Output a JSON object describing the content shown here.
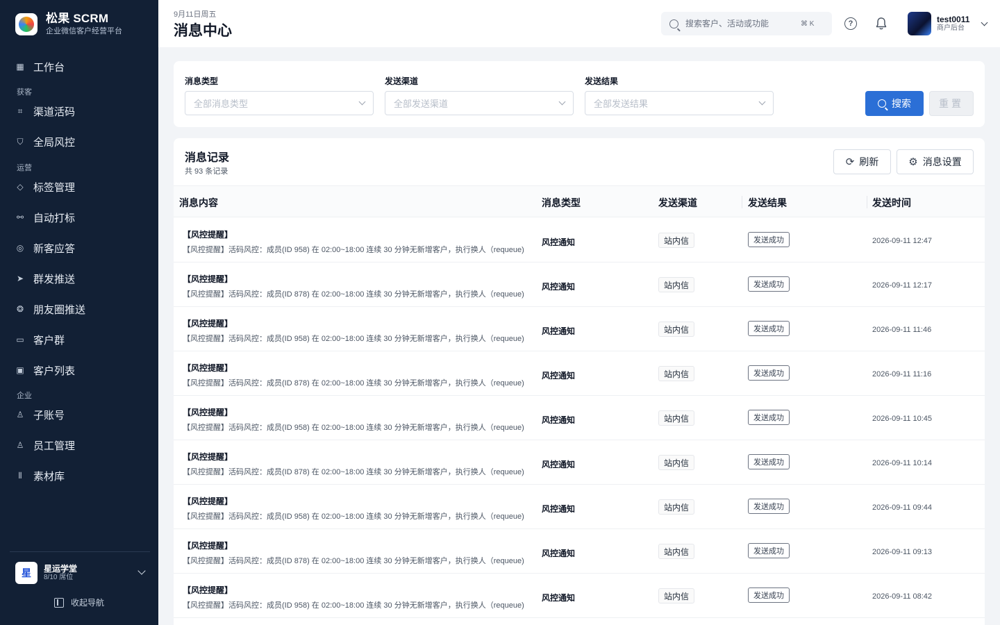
{
  "brand": {
    "title": "松果 SCRM",
    "subtitle": "企业微信客户经营平台"
  },
  "sidebar": {
    "groups": {
      "acquire": "获客",
      "operate": "运营",
      "enterprise": "企业"
    },
    "items": [
      {
        "label": "工作台",
        "icon": "dashboard-icon"
      },
      {
        "label": "渠道活码",
        "icon": "qrcode-icon"
      },
      {
        "label": "全局风控",
        "icon": "shield-icon"
      },
      {
        "label": "标签管理",
        "icon": "tag-icon"
      },
      {
        "label": "自动打标",
        "icon": "auto-tag-icon"
      },
      {
        "label": "新客应答",
        "icon": "chat-reply-icon"
      },
      {
        "label": "群发推送",
        "icon": "send-icon"
      },
      {
        "label": "朋友圈推送",
        "icon": "moments-icon"
      },
      {
        "label": "客户群",
        "icon": "group-chat-icon"
      },
      {
        "label": "客户列表",
        "icon": "contact-icon"
      },
      {
        "label": "子账号",
        "icon": "user-icon"
      },
      {
        "label": "员工管理",
        "icon": "staff-icon"
      },
      {
        "label": "素材库",
        "icon": "library-icon"
      }
    ],
    "workspace": {
      "avatar": "星",
      "name": "星运学堂",
      "seats": "8/10 席位"
    },
    "collapse_label": "收起导航"
  },
  "header": {
    "date": "9月11日周五",
    "title": "消息中心",
    "search_placeholder": "搜索客户、活动或功能",
    "shortcut": "⌘ K",
    "user_name": "test0011",
    "user_role": "商户后台"
  },
  "filters": {
    "type": {
      "label": "消息类型",
      "placeholder": "全部消息类型"
    },
    "channel": {
      "label": "发送渠道",
      "placeholder": "全部发送渠道"
    },
    "result": {
      "label": "发送结果",
      "placeholder": "全部发送结果"
    },
    "search_label": "搜索",
    "reset_label": "重置"
  },
  "records": {
    "title": "消息记录",
    "count": "共 93 条记录",
    "refresh_label": "刷新",
    "settings_label": "消息设置",
    "columns": [
      "消息内容",
      "消息类型",
      "发送渠道",
      "发送结果",
      "发送时间"
    ],
    "rows": [
      {
        "title": "【风控提醒】",
        "desc": "【风控提醒】活码风控：成员(ID 958) 在 02:00~18:00 连续 30 分钟无新增客户，执行换人（requeue)",
        "type": "风控通知",
        "channel": "站内信",
        "result": "发送成功",
        "time": "2026-09-11 12:47"
      },
      {
        "title": "【风控提醒】",
        "desc": "【风控提醒】活码风控：成员(ID 878) 在 02:00~18:00 连续 30 分钟无新增客户，执行换人（requeue)",
        "type": "风控通知",
        "channel": "站内信",
        "result": "发送成功",
        "time": "2026-09-11 12:17"
      },
      {
        "title": "【风控提醒】",
        "desc": "【风控提醒】活码风控：成员(ID 958) 在 02:00~18:00 连续 30 分钟无新增客户，执行换人（requeue)",
        "type": "风控通知",
        "channel": "站内信",
        "result": "发送成功",
        "time": "2026-09-11 11:46"
      },
      {
        "title": "【风控提醒】",
        "desc": "【风控提醒】活码风控：成员(ID 878) 在 02:00~18:00 连续 30 分钟无新增客户，执行换人（requeue)",
        "type": "风控通知",
        "channel": "站内信",
        "result": "发送成功",
        "time": "2026-09-11 11:16"
      },
      {
        "title": "【风控提醒】",
        "desc": "【风控提醒】活码风控：成员(ID 958) 在 02:00~18:00 连续 30 分钟无新增客户，执行换人（requeue)",
        "type": "风控通知",
        "channel": "站内信",
        "result": "发送成功",
        "time": "2026-09-11 10:45"
      },
      {
        "title": "【风控提醒】",
        "desc": "【风控提醒】活码风控：成员(ID 878) 在 02:00~18:00 连续 30 分钟无新增客户，执行换人（requeue)",
        "type": "风控通知",
        "channel": "站内信",
        "result": "发送成功",
        "time": "2026-09-11 10:14"
      },
      {
        "title": "【风控提醒】",
        "desc": "【风控提醒】活码风控：成员(ID 958) 在 02:00~18:00 连续 30 分钟无新增客户，执行换人（requeue)",
        "type": "风控通知",
        "channel": "站内信",
        "result": "发送成功",
        "time": "2026-09-11 09:44"
      },
      {
        "title": "【风控提醒】",
        "desc": "【风控提醒】活码风控：成员(ID 878) 在 02:00~18:00 连续 30 分钟无新增客户，执行换人（requeue)",
        "type": "风控通知",
        "channel": "站内信",
        "result": "发送成功",
        "time": "2026-09-11 09:13"
      },
      {
        "title": "【风控提醒】",
        "desc": "【风控提醒】活码风控：成员(ID 958) 在 02:00~18:00 连续 30 分钟无新增客户，执行换人（requeue)",
        "type": "风控通知",
        "channel": "站内信",
        "result": "发送成功",
        "time": "2026-09-11 08:42"
      }
    ]
  },
  "colors": {
    "sidebar_bg": "#122035",
    "primary": "#2b6fd6",
    "page_bg": "#f2f4f7"
  }
}
